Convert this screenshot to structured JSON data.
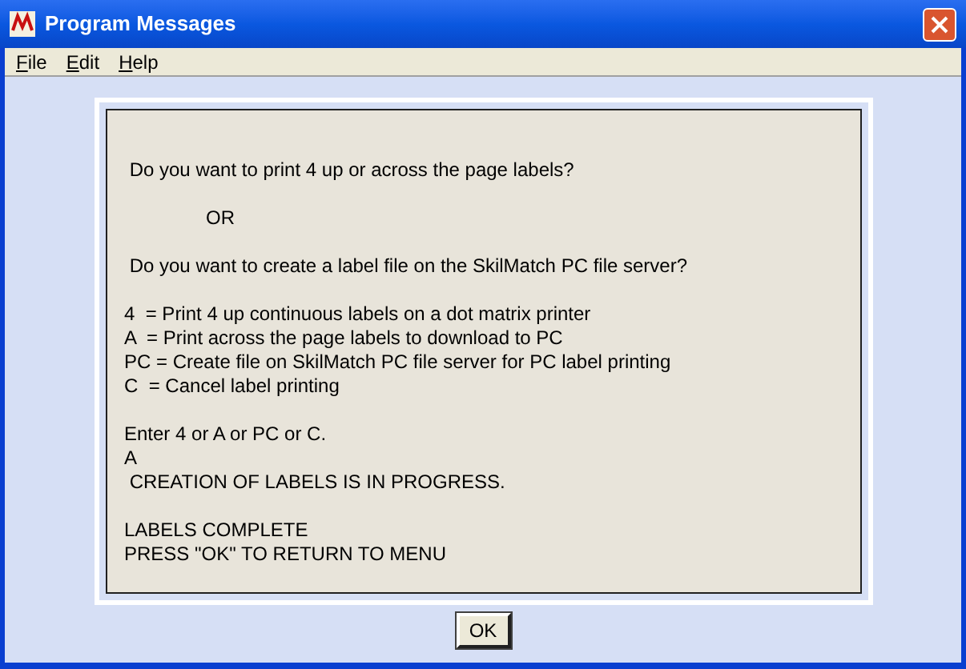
{
  "window": {
    "title": "Program Messages"
  },
  "menu": [
    {
      "label": "File"
    },
    {
      "label": "Edit"
    },
    {
      "label": "Help"
    }
  ],
  "message": {
    "paragraphs": [
      [
        {
          "text": " Do you want to print 4 up or across the page labels?",
          "kind": "plain"
        }
      ],
      [
        {
          "text": "OR",
          "kind": "indented"
        }
      ],
      [
        {
          "text": " Do you want to create a label file on the SkilMatch PC file server?",
          "kind": "plain"
        }
      ],
      [
        {
          "text": "4  = Print 4 up continuous labels on a dot matrix printer",
          "kind": "plain"
        },
        {
          "text": "A  = Print across the page labels to download to PC",
          "kind": "plain"
        },
        {
          "text": "PC = Create file on SkilMatch PC file server for PC label printing",
          "kind": "plain"
        },
        {
          "text": "C  = Cancel label printing",
          "kind": "plain"
        }
      ],
      [
        {
          "text": "Enter 4 or A or PC or C.",
          "kind": "plain"
        },
        {
          "text": "A",
          "kind": "plain"
        },
        {
          "text": " CREATION OF LABELS IS IN PROGRESS.",
          "kind": "plain"
        }
      ],
      [
        {
          "text": "LABELS COMPLETE",
          "kind": "plain"
        },
        {
          "text": "PRESS \"OK\" TO RETURN TO MENU",
          "kind": "plain"
        }
      ]
    ]
  },
  "buttons": [
    "OK"
  ]
}
